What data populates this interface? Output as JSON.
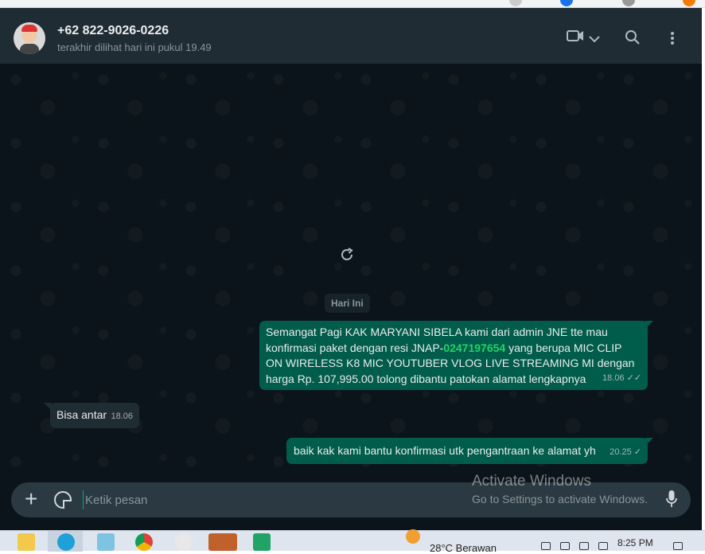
{
  "header": {
    "contact_name": "+62 822-9026-0226",
    "status": "terakhir dilihat hari ini pukul 19.49",
    "icons": [
      "video-call-icon",
      "chevron-down-icon",
      "search-icon",
      "menu-icon"
    ]
  },
  "chat": {
    "date_divider": "Hari Ini",
    "messages": [
      {
        "direction": "out",
        "text_before": "Semangat Pagi KAK MARYANI SIBELA kami dari admin JNE tte mau konfirmasi paket dengan resi JNAP-",
        "highlight": "0247197654",
        "text_after": " yang berupa MIC CLIP ON WIRELESS K8 MIC YOUTUBER VLOG LIVE STREAMING MI dengan harga Rp. 107,995.00 tolong dibantu patokan alamat lengkapnya",
        "time": "18.06",
        "ticks": "✓✓"
      },
      {
        "direction": "in",
        "text": "Bisa antar",
        "time": "18.06"
      },
      {
        "direction": "out",
        "text": "baik kak kami bantu konfirmasi utk pengantraan ke alamat yh",
        "time": "20.25",
        "ticks": "✓"
      }
    ]
  },
  "composer": {
    "placeholder": "Ketik pesan"
  },
  "watermark": {
    "line1": "Activate Windows",
    "line2": "Go to Settings to activate Windows."
  },
  "taskbar": {
    "weather": "28°C  Berawan",
    "time": "8:25 PM"
  },
  "colors": {
    "outgoing_bubble": "#005c4b",
    "incoming_bubble": "#202c33",
    "chat_background": "#0b141a",
    "header_background": "#202c33",
    "highlight_number": "#25d366"
  }
}
